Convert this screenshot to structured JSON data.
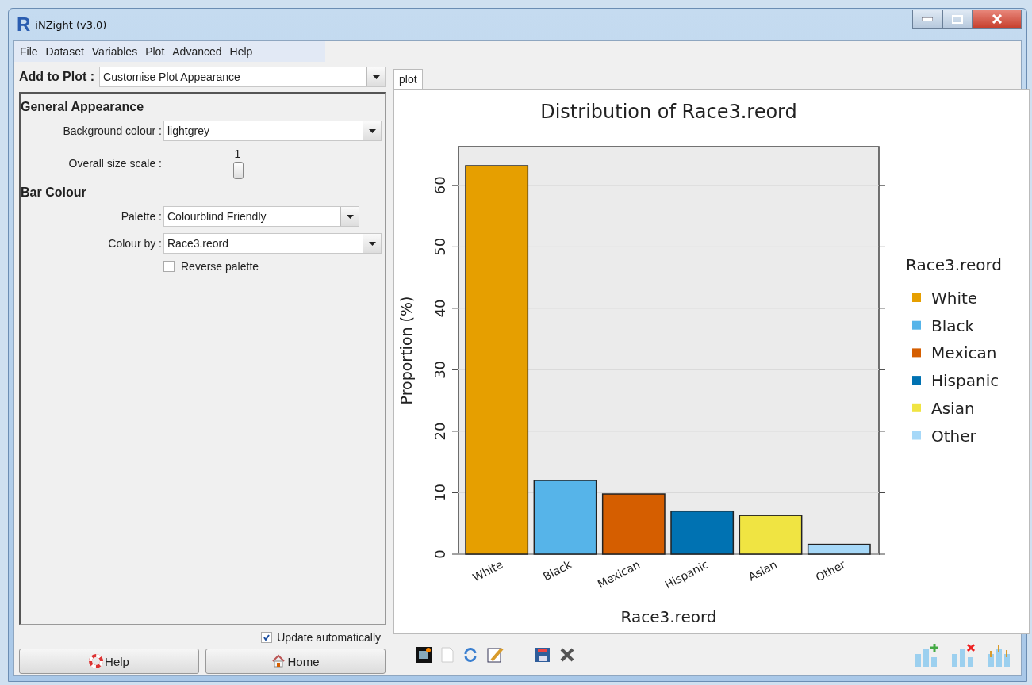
{
  "window": {
    "logo": "R",
    "title": "iNZight (v3.0)"
  },
  "menu": [
    "File",
    "Dataset",
    "Variables",
    "Plot",
    "Advanced",
    "Help"
  ],
  "add_to_plot": {
    "label": "Add to Plot :",
    "value": "Customise Plot Appearance"
  },
  "sections": [
    {
      "heading": "General Appearance",
      "rows": [
        {
          "kind": "dropdown",
          "label": "Background colour :",
          "value": "lightgrey",
          "wide": true
        },
        {
          "kind": "slider",
          "label": "Overall size scale :",
          "reading": "1",
          "level": 0.34
        }
      ]
    },
    {
      "heading": "Bar Colour",
      "rows": [
        {
          "kind": "dropdown",
          "label": "Palette :",
          "value": "Colourblind Friendly",
          "wide": false
        },
        {
          "kind": "dropdown",
          "label": "Colour by :",
          "value": "Race3.reord",
          "wide": true
        },
        {
          "kind": "checkbox",
          "label": "Reverse palette",
          "checked": false
        }
      ]
    }
  ],
  "update_automatically": {
    "label": "Update automatically",
    "checked": true
  },
  "buttons": [
    "Help",
    "Home"
  ],
  "tabs": [
    {
      "label": "plot",
      "selected": true
    }
  ],
  "plot": {
    "chart_data": {
      "type": "bar",
      "title": "Distribution of Race3.reord",
      "xlabel": "Race3.reord",
      "ylabel": "Proportion (%)",
      "categories": [
        "White",
        "Black",
        "Mexican",
        "Hispanic",
        "Asian",
        "Other"
      ],
      "values": [
        63.2,
        12.0,
        9.8,
        7.0,
        6.3,
        1.6
      ],
      "ylim": [
        0,
        66.3
      ],
      "grid": true,
      "yticks": [
        0,
        10,
        20,
        30,
        40,
        50,
        60
      ]
    },
    "legend": {
      "title": "Race3.reord",
      "items": [
        {
          "label": "White",
          "color": "#e69f00"
        },
        {
          "label": "Black",
          "color": "#56b4e9"
        },
        {
          "label": "Mexican",
          "color": "#d55e00"
        },
        {
          "label": "Hispanic",
          "color": "#0072b2"
        },
        {
          "label": "Asian",
          "color": "#f0e442"
        },
        {
          "label": "Other",
          "color": "#a6d8f8"
        }
      ]
    }
  }
}
